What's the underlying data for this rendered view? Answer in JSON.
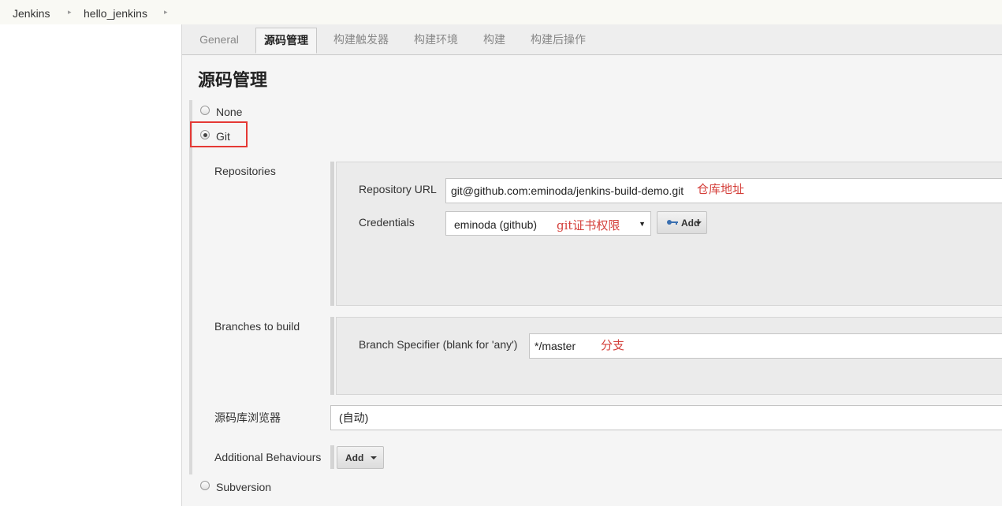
{
  "breadcrumb": {
    "items": [
      "Jenkins",
      "hello_jenkins"
    ]
  },
  "tabs": [
    {
      "label": "General",
      "active": false
    },
    {
      "label": "源码管理",
      "active": true
    },
    {
      "label": "构建触发器",
      "active": false
    },
    {
      "label": "构建环境",
      "active": false
    },
    {
      "label": "构建",
      "active": false
    },
    {
      "label": "构建后操作",
      "active": false
    }
  ],
  "section_title": "源码管理",
  "scm": {
    "options": [
      {
        "label": "None",
        "selected": false
      },
      {
        "label": "Git",
        "selected": true
      },
      {
        "label": "Subversion",
        "selected": false
      }
    ],
    "repositories_label": "Repositories",
    "repository_url_label": "Repository URL",
    "repository_url_value": "git@github.com:eminoda/jenkins-build-demo.git",
    "repository_url_note": "仓库地址",
    "credentials_label": "Credentials",
    "credentials_value": "eminoda (github)",
    "credentials_note": "git证书权限",
    "credentials_add_label": "Add",
    "branches_label": "Branches to build",
    "branch_specifier_label": "Branch Specifier (blank for 'any')",
    "branch_specifier_value": "*/master",
    "branch_note": "分支",
    "browser_label": "源码库浏览器",
    "browser_value": "(自动)",
    "additional_behaviours_label": "Additional Behaviours",
    "additional_add_label": "Add"
  },
  "colors": {
    "highlight": "#e53935",
    "note": "#d43f3a"
  }
}
